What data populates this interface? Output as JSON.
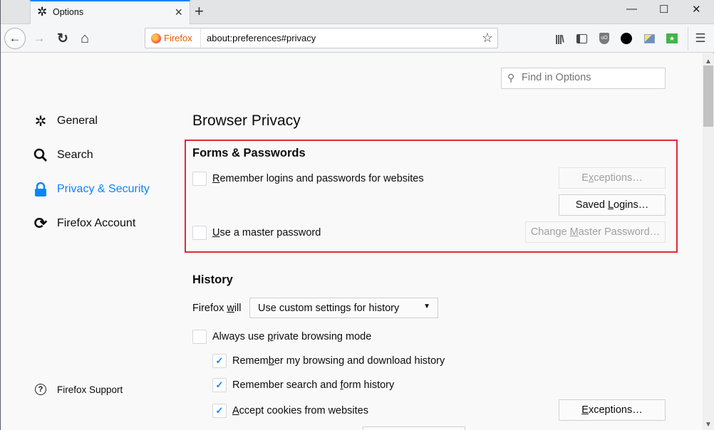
{
  "tab": {
    "icon": "gear-icon",
    "title": "Options",
    "close": "×"
  },
  "newtab": "+",
  "window_controls": {
    "minimize": "—",
    "maximize": "☐",
    "close": "✕"
  },
  "navbar": {
    "back": "←",
    "forward": "→",
    "reload": "↻",
    "home": "⌂",
    "identity_label": "Firefox",
    "url": "about:preferences#privacy",
    "bookmark_star": "☆",
    "menu": "☰"
  },
  "search": {
    "placeholder": "Find in Options",
    "icon": "⚲"
  },
  "sidebar": {
    "items": [
      {
        "label": "General",
        "icon": "⚙",
        "active": false
      },
      {
        "label": "Search",
        "icon": "🔍",
        "active": false
      },
      {
        "label": "Privacy & Security",
        "icon": "🔒",
        "active": true
      },
      {
        "label": "Firefox Account",
        "icon": "⟳",
        "active": false
      }
    ],
    "support_label": "Firefox Support",
    "support_icon": "?"
  },
  "main": {
    "title": "Browser Privacy",
    "forms": {
      "heading": "Forms & Passwords",
      "remember_logins": {
        "label_accel": "R",
        "label_rest": "emember logins and passwords for websites",
        "checked": false
      },
      "master_password": {
        "label_accel": "U",
        "label_rest": "se a master password",
        "checked": false
      },
      "exceptions_btn": {
        "pre": "E",
        "accel": "x",
        "post": "ceptions…",
        "disabled": true
      },
      "saved_logins_btn": {
        "pre": "Saved ",
        "accel": "L",
        "post": "ogins…",
        "disabled": false
      },
      "change_master_btn": {
        "pre": "Change ",
        "accel": "M",
        "post": "aster Password…",
        "disabled": true
      }
    },
    "history": {
      "heading": "History",
      "firefox_will_pre": "Firefox ",
      "firefox_will_accel": "w",
      "firefox_will_post": "ill",
      "select_value": "Use custom settings for history",
      "private_mode": {
        "pre": "Always use ",
        "accel": "p",
        "post": "rivate browsing mode",
        "checked": false
      },
      "remember_browsing": {
        "pre": "Remem",
        "accel": "b",
        "post": "er my browsing and download history",
        "checked": true
      },
      "remember_search": {
        "pre": "Remember search and ",
        "accel": "f",
        "post": "orm history",
        "checked": true
      },
      "accept_cookies": {
        "pre": "",
        "accel": "A",
        "post": "ccept cookies from websites",
        "checked": true
      },
      "cookies_exceptions_btn": {
        "pre": "",
        "accel": "E",
        "post": "xceptions…"
      }
    }
  }
}
